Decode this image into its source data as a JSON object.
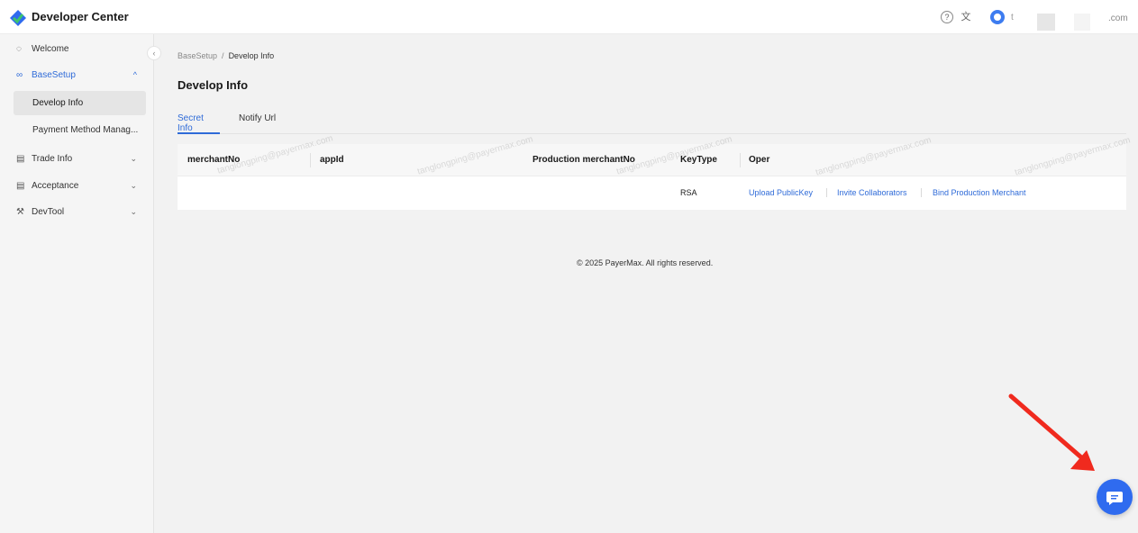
{
  "header": {
    "app_title": "Developer Center",
    "help_icon": "help-circle-icon",
    "translate_icon": "translate-icon",
    "user_prefix": "t",
    "user_suffix": ".com"
  },
  "sidebar": {
    "welcome": "Welcome",
    "basesetup": "BaseSetup",
    "develop_info": "Develop Info",
    "payment_method": "Payment Method Manag...",
    "trade_info": "Trade Info",
    "acceptance": "Acceptance",
    "devtool": "DevTool",
    "collapse_glyph": "‹",
    "chev_up": "^",
    "chev_down": "⌄"
  },
  "breadcrumb": {
    "parent": "BaseSetup",
    "separator": "/",
    "current": "Develop Info"
  },
  "page_title": "Develop Info",
  "tabs": {
    "secret": "Secret Info",
    "notify": "Notify Url"
  },
  "table": {
    "headers": {
      "merchant_no": "merchantNo",
      "app_id": "appId",
      "production_merchant_no": "Production merchantNo",
      "key_type": "KeyType",
      "oper": "Oper"
    },
    "row": {
      "key_type": "RSA",
      "upload_public_key": "Upload PublicKey",
      "invite_collaborators": "Invite Collaborators",
      "bind_production_merchant": "Bind Production Merchant"
    }
  },
  "footer": "© 2025 PayerMax. All rights reserved.",
  "watermark": "tanglongping@payermax.com",
  "colors": {
    "accent": "#2f6bd8",
    "chat_button": "#2f6bef",
    "arrow": "#f02a1e"
  }
}
